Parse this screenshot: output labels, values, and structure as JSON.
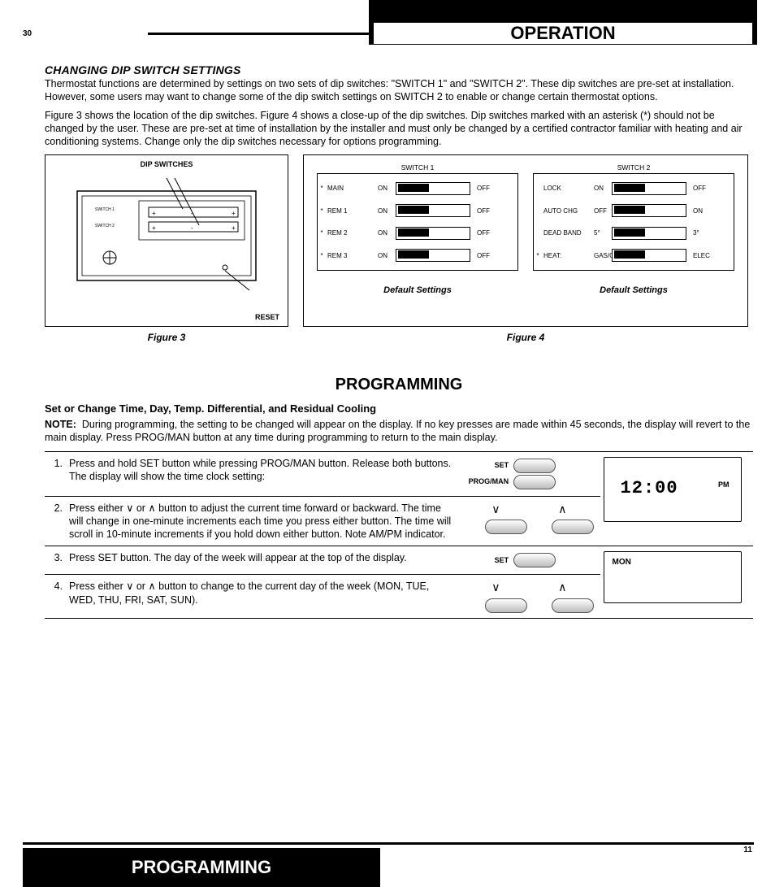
{
  "page": {
    "num_top_left": "30",
    "num_bottom_right": "11",
    "header_title": "OPERATION",
    "footer_title": "PROGRAMMING"
  },
  "dip": {
    "heading": "CHANGING DIP SWITCH SETTINGS",
    "para1": "Thermostat functions are determined by settings on two sets of dip switches:  \"SWITCH 1\" and \"SWITCH 2\". These dip switches are pre-set at installation.  However, some users may want to change some of the dip switch settings on SWITCH 2 to enable or change certain thermostat options.",
    "para2": "Figure 3 shows the location of the dip switches. Figure 4 shows a close-up of the dip switches. Dip switches marked with an asterisk (*) should not be changed by the user. These are pre-set at time of installation by the installer and must only be changed by a certified contractor familiar with heating and air conditioning systems. Change only the dip switches necessary for options programming."
  },
  "fig3": {
    "dip_label": "DIP SWITCHES",
    "sw1_text": "SWITCH 1",
    "sw2_text": "SWITCH 2",
    "reset": "RESET",
    "caption": "Figure 3"
  },
  "fig4": {
    "caption": "Figure 4",
    "default": "Default Settings",
    "sw1": {
      "title": "SWITCH 1",
      "rows": [
        {
          "star": "*",
          "label": "MAIN",
          "on": "ON",
          "off": "OFF",
          "pos": "left"
        },
        {
          "star": "*",
          "label": "REM 1",
          "on": "ON",
          "off": "OFF",
          "pos": "left"
        },
        {
          "star": "*",
          "label": "REM 2",
          "on": "ON",
          "off": "OFF",
          "pos": "left"
        },
        {
          "star": "*",
          "label": "REM 3",
          "on": "ON",
          "off": "OFF",
          "pos": "left"
        }
      ]
    },
    "sw2": {
      "title": "SWITCH 2",
      "rows": [
        {
          "star": "",
          "label": "LOCK",
          "on": "ON",
          "off": "OFF",
          "pos": "left"
        },
        {
          "star": "",
          "label": "AUTO CHG",
          "on": "OFF",
          "off": "ON",
          "pos": "left"
        },
        {
          "star": "",
          "label": "DEAD BAND",
          "on": "5°",
          "off": "3°",
          "pos": "left"
        },
        {
          "star": "*",
          "label": "HEAT:",
          "on": "GAS/OIL",
          "off": "ELEC",
          "pos": "left"
        }
      ]
    }
  },
  "prog": {
    "title": "PROGRAMMING",
    "subhead": "Set or Change Time, Day, Temp. Differential, and Residual Cooling",
    "note_label": "NOTE:",
    "note_text": "During programming, the setting to be changed will appear on the display. If no key presses are made within 45 seconds, the display will revert to the  main display. Press PROG/MAN button at any time during programming to return to the main display.",
    "steps": [
      {
        "n": "1.",
        "text": "Press and hold SET button while pressing PROG/MAN button. Release both buttons. The display will show the time clock setting:",
        "buttons": [
          {
            "label": "SET"
          },
          {
            "label": "PROG/MAN"
          }
        ],
        "lcd": {
          "time": "12:00",
          "pm": "PM"
        }
      },
      {
        "n": "2.",
        "text_pre": "Press either ",
        "text_mid": " or ",
        "text_post": " button to adjust the current time forward or backward.  The time will change in one-minute increments each time you press either button. The time will scroll in 10-minute increments if you hold down either button. Note AM/PM indicator.",
        "arrows": true
      },
      {
        "n": "3.",
        "text": "Press SET button. The day of the week will appear at the top of the display.",
        "buttons": [
          {
            "label": "SET"
          }
        ],
        "lcd": {
          "day": "MON"
        }
      },
      {
        "n": "4.",
        "text_pre": "Press either ",
        "text_mid": " or ",
        "text_post": " button to change to the current day of the week  (MON, TUE, WED, THU, FRI, SAT, SUN).",
        "arrows": true
      }
    ]
  }
}
